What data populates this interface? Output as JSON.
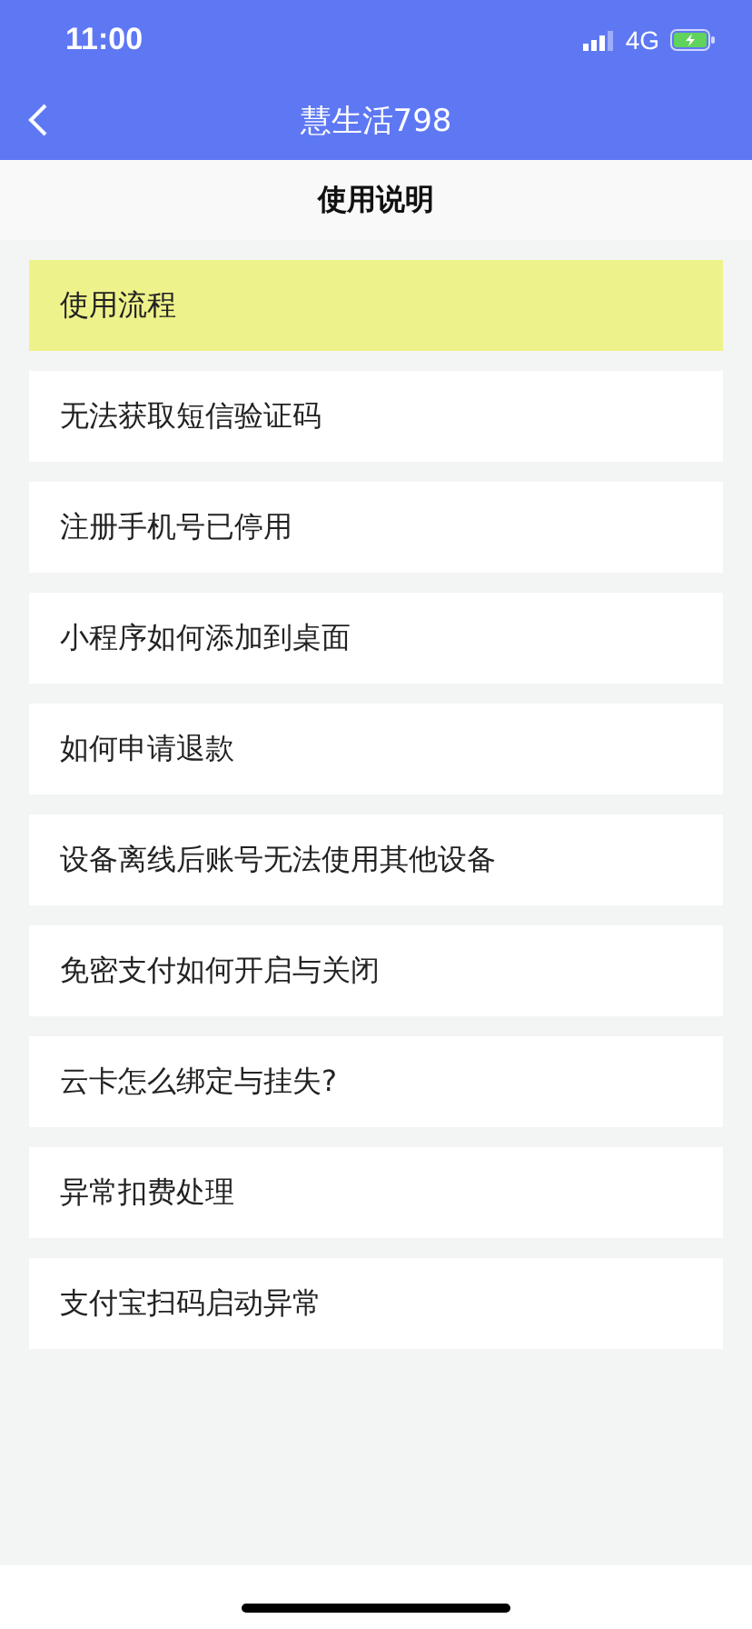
{
  "status_bar": {
    "time": "11:00",
    "network": "4G"
  },
  "nav_bar": {
    "title": "慧生活798"
  },
  "page_title": "使用说明",
  "items": [
    {
      "label": "使用流程",
      "selected": true
    },
    {
      "label": "无法获取短信验证码",
      "selected": false
    },
    {
      "label": "注册手机号已停用",
      "selected": false
    },
    {
      "label": "小程序如何添加到桌面",
      "selected": false
    },
    {
      "label": "如何申请退款",
      "selected": false
    },
    {
      "label": "设备离线后账号无法使用其他设备",
      "selected": false
    },
    {
      "label": "免密支付如何开启与关闭",
      "selected": false
    },
    {
      "label": "云卡怎么绑定与挂失?",
      "selected": false
    },
    {
      "label": "异常扣费处理",
      "selected": false
    },
    {
      "label": "支付宝扫码启动异常",
      "selected": false
    }
  ]
}
